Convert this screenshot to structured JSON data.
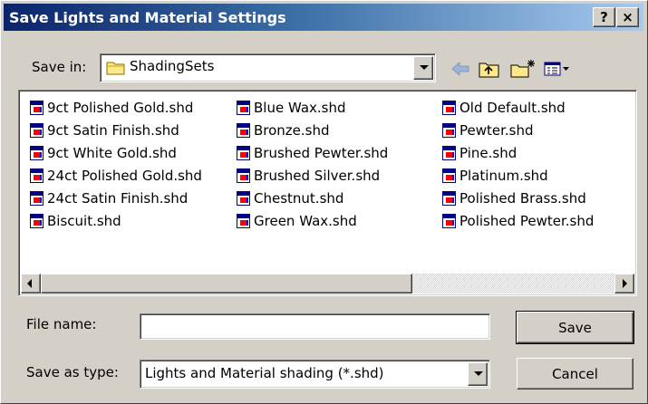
{
  "window": {
    "title": "Save Lights and Material Settings",
    "help_label": "?",
    "close_label": "×"
  },
  "save_in": {
    "label": "Save in:",
    "value": "ShadingSets"
  },
  "toolbar": {
    "icons": [
      "back-arrow-icon",
      "up-folder-icon",
      "new-folder-icon",
      "view-menu-icon"
    ]
  },
  "files": {
    "columns": [
      [
        "9ct Polished Gold.shd",
        "9ct Satin Finish.shd",
        "9ct White Gold.shd",
        "24ct Polished Gold.shd",
        "24ct Satin Finish.shd",
        "Biscuit.shd"
      ],
      [
        "Blue Wax.shd",
        "Bronze.shd",
        "Brushed Pewter.shd",
        "Brushed Silver.shd",
        "Chestnut.shd",
        "Green Wax.shd"
      ],
      [
        "Old Default.shd",
        "Pewter.shd",
        "Pine.shd",
        "Platinum.shd",
        "Polished Brass.shd",
        "Polished Pewter.shd"
      ]
    ]
  },
  "file_name": {
    "label": "File name:",
    "value": ""
  },
  "save_type": {
    "label": "Save as type:",
    "value": "Lights and Material shading (*.shd)"
  },
  "buttons": {
    "save": "Save",
    "cancel": "Cancel"
  },
  "colors": {
    "titlebar_start": "#0a246a",
    "titlebar_end": "#a6caf0",
    "face": "#d4d0c8"
  }
}
